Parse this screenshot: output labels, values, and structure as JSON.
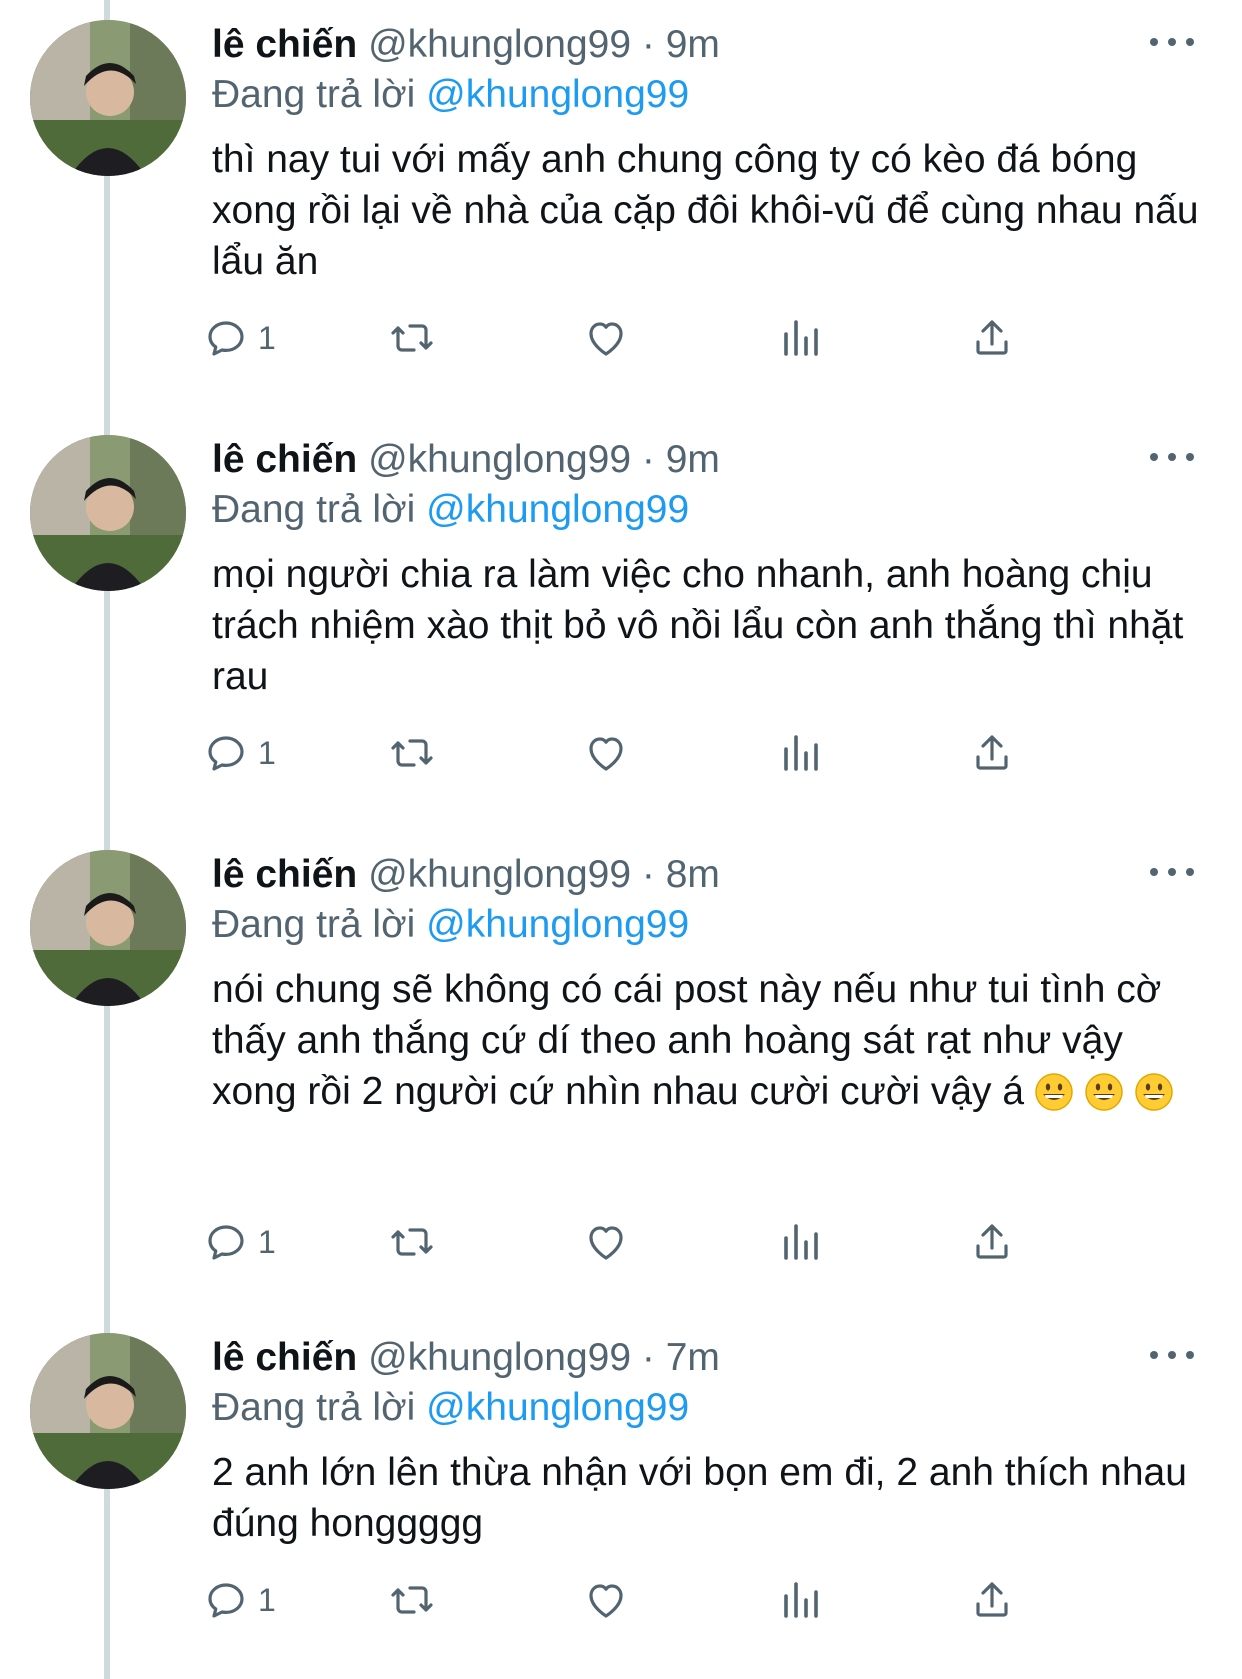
{
  "tweets": [
    {
      "name": "lê chiến",
      "handle": "@khunglong99",
      "separator": "·",
      "time": "9m",
      "reply_prefix": "Đang trả lời",
      "reply_to": "@khunglong99",
      "text": "thì nay tui với mấy anh chung công ty có kèo đá bóng xong rồi lại về nhà của cặp đôi khôi-vũ để cùng nhau nấu lẩu ăn",
      "reply_count": "1"
    },
    {
      "name": "lê chiến",
      "handle": "@khunglong99",
      "separator": "·",
      "time": "9m",
      "reply_prefix": "Đang trả lời",
      "reply_to": "@khunglong99",
      "text": "mọi người chia ra làm việc cho nhanh, anh hoàng chịu trách nhiệm xào thịt bỏ vô nồi lẩu còn anh thắng thì nhặt rau",
      "reply_count": "1"
    },
    {
      "name": "lê chiến",
      "handle": "@khunglong99",
      "separator": "·",
      "time": "8m",
      "reply_prefix": "Đang trả lời",
      "reply_to": "@khunglong99",
      "text": "nói chung sẽ không có cái post này nếu như tui tình cờ thấy anh thắng cứ dí theo anh hoàng sát rạt như vậy xong rồi 2 người cứ nhìn nhau cười cười vậy á",
      "emoji_icons": [
        "grinning-face-emoji",
        "grinning-face-emoji",
        "grinning-face-emoji"
      ],
      "reply_count": "1"
    },
    {
      "name": "lê chiến",
      "handle": "@khunglong99",
      "separator": "·",
      "time": "7m",
      "reply_prefix": "Đang trả lời",
      "reply_to": "@khunglong99",
      "text": "2 anh lớn lên thừa nhận với bọn em đi, 2 anh thích nhau đúng honggggg",
      "reply_count": "1"
    }
  ],
  "icons": {
    "reply": "reply-icon",
    "retweet": "retweet-icon",
    "like": "heart-icon",
    "views": "views-bar-chart-icon",
    "share": "share-icon",
    "more": "more-options-icon"
  },
  "colors": {
    "text": "#0f1419",
    "secondary": "#536471",
    "mention": "#1d9bf0",
    "thread_line": "#cfd9de"
  }
}
